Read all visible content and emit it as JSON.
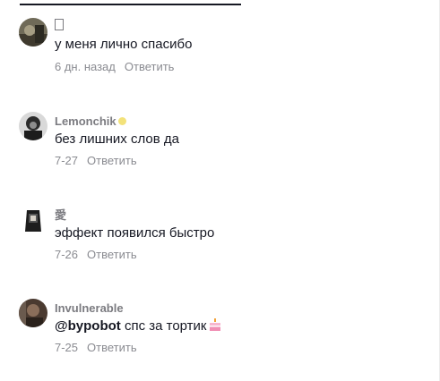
{
  "comments": [
    {
      "author": "",
      "text": "у меня лично спасибо",
      "time": "6 дн. назад",
      "reply_label": "Ответить"
    },
    {
      "author": "Lemonchik",
      "text": "без лишних слов да",
      "time": "7-27",
      "reply_label": "Ответить"
    },
    {
      "author": "愛",
      "text": "эффект появился быстро",
      "time": "7-26",
      "reply_label": "Ответить"
    },
    {
      "author": "Invulnerable",
      "mention": "@bypobot",
      "text": " спс за тортик",
      "time": "7-25",
      "reply_label": "Ответить"
    }
  ],
  "icons": {
    "online_indicator": "online-dot-icon",
    "cake": "cake-icon"
  },
  "colors": {
    "text": "#161823",
    "secondary": "#8a8b91",
    "online": "#f3e27a"
  }
}
